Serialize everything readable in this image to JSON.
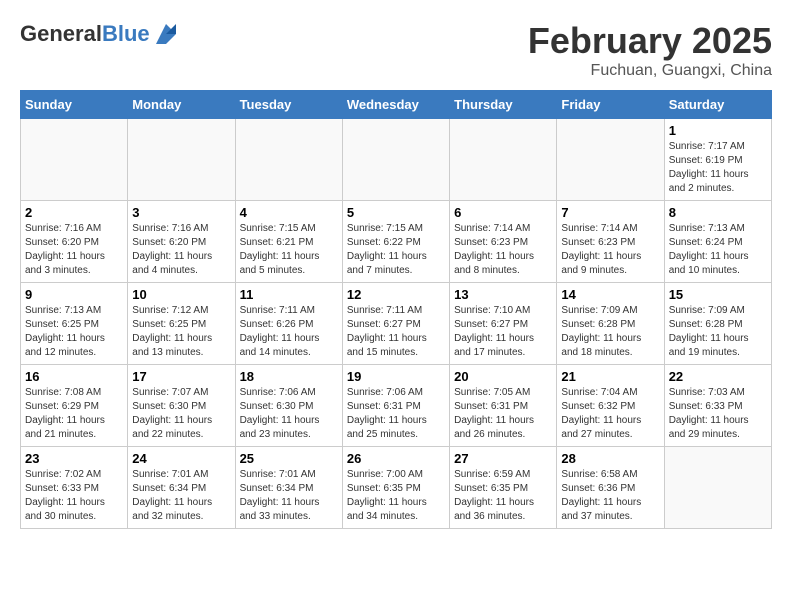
{
  "header": {
    "logo_general": "General",
    "logo_blue": "Blue",
    "title": "February 2025",
    "subtitle": "Fuchuan, Guangxi, China"
  },
  "days_of_week": [
    "Sunday",
    "Monday",
    "Tuesday",
    "Wednesday",
    "Thursday",
    "Friday",
    "Saturday"
  ],
  "weeks": [
    [
      {
        "day": "",
        "info": ""
      },
      {
        "day": "",
        "info": ""
      },
      {
        "day": "",
        "info": ""
      },
      {
        "day": "",
        "info": ""
      },
      {
        "day": "",
        "info": ""
      },
      {
        "day": "",
        "info": ""
      },
      {
        "day": "1",
        "info": "Sunrise: 7:17 AM\nSunset: 6:19 PM\nDaylight: 11 hours and 2 minutes."
      }
    ],
    [
      {
        "day": "2",
        "info": "Sunrise: 7:16 AM\nSunset: 6:20 PM\nDaylight: 11 hours and 3 minutes."
      },
      {
        "day": "3",
        "info": "Sunrise: 7:16 AM\nSunset: 6:20 PM\nDaylight: 11 hours and 4 minutes."
      },
      {
        "day": "4",
        "info": "Sunrise: 7:15 AM\nSunset: 6:21 PM\nDaylight: 11 hours and 5 minutes."
      },
      {
        "day": "5",
        "info": "Sunrise: 7:15 AM\nSunset: 6:22 PM\nDaylight: 11 hours and 7 minutes."
      },
      {
        "day": "6",
        "info": "Sunrise: 7:14 AM\nSunset: 6:23 PM\nDaylight: 11 hours and 8 minutes."
      },
      {
        "day": "7",
        "info": "Sunrise: 7:14 AM\nSunset: 6:23 PM\nDaylight: 11 hours and 9 minutes."
      },
      {
        "day": "8",
        "info": "Sunrise: 7:13 AM\nSunset: 6:24 PM\nDaylight: 11 hours and 10 minutes."
      }
    ],
    [
      {
        "day": "9",
        "info": "Sunrise: 7:13 AM\nSunset: 6:25 PM\nDaylight: 11 hours and 12 minutes."
      },
      {
        "day": "10",
        "info": "Sunrise: 7:12 AM\nSunset: 6:25 PM\nDaylight: 11 hours and 13 minutes."
      },
      {
        "day": "11",
        "info": "Sunrise: 7:11 AM\nSunset: 6:26 PM\nDaylight: 11 hours and 14 minutes."
      },
      {
        "day": "12",
        "info": "Sunrise: 7:11 AM\nSunset: 6:27 PM\nDaylight: 11 hours and 15 minutes."
      },
      {
        "day": "13",
        "info": "Sunrise: 7:10 AM\nSunset: 6:27 PM\nDaylight: 11 hours and 17 minutes."
      },
      {
        "day": "14",
        "info": "Sunrise: 7:09 AM\nSunset: 6:28 PM\nDaylight: 11 hours and 18 minutes."
      },
      {
        "day": "15",
        "info": "Sunrise: 7:09 AM\nSunset: 6:28 PM\nDaylight: 11 hours and 19 minutes."
      }
    ],
    [
      {
        "day": "16",
        "info": "Sunrise: 7:08 AM\nSunset: 6:29 PM\nDaylight: 11 hours and 21 minutes."
      },
      {
        "day": "17",
        "info": "Sunrise: 7:07 AM\nSunset: 6:30 PM\nDaylight: 11 hours and 22 minutes."
      },
      {
        "day": "18",
        "info": "Sunrise: 7:06 AM\nSunset: 6:30 PM\nDaylight: 11 hours and 23 minutes."
      },
      {
        "day": "19",
        "info": "Sunrise: 7:06 AM\nSunset: 6:31 PM\nDaylight: 11 hours and 25 minutes."
      },
      {
        "day": "20",
        "info": "Sunrise: 7:05 AM\nSunset: 6:31 PM\nDaylight: 11 hours and 26 minutes."
      },
      {
        "day": "21",
        "info": "Sunrise: 7:04 AM\nSunset: 6:32 PM\nDaylight: 11 hours and 27 minutes."
      },
      {
        "day": "22",
        "info": "Sunrise: 7:03 AM\nSunset: 6:33 PM\nDaylight: 11 hours and 29 minutes."
      }
    ],
    [
      {
        "day": "23",
        "info": "Sunrise: 7:02 AM\nSunset: 6:33 PM\nDaylight: 11 hours and 30 minutes."
      },
      {
        "day": "24",
        "info": "Sunrise: 7:01 AM\nSunset: 6:34 PM\nDaylight: 11 hours and 32 minutes."
      },
      {
        "day": "25",
        "info": "Sunrise: 7:01 AM\nSunset: 6:34 PM\nDaylight: 11 hours and 33 minutes."
      },
      {
        "day": "26",
        "info": "Sunrise: 7:00 AM\nSunset: 6:35 PM\nDaylight: 11 hours and 34 minutes."
      },
      {
        "day": "27",
        "info": "Sunrise: 6:59 AM\nSunset: 6:35 PM\nDaylight: 11 hours and 36 minutes."
      },
      {
        "day": "28",
        "info": "Sunrise: 6:58 AM\nSunset: 6:36 PM\nDaylight: 11 hours and 37 minutes."
      },
      {
        "day": "",
        "info": ""
      }
    ]
  ]
}
